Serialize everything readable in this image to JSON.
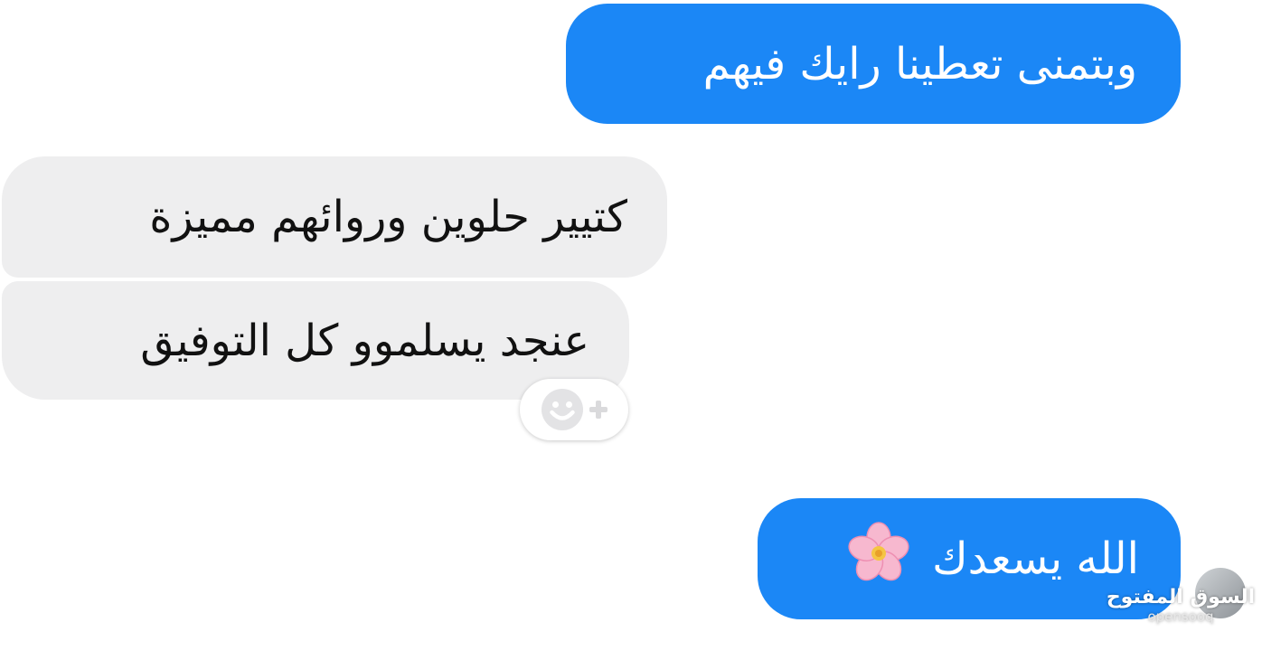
{
  "conversation": {
    "messages": [
      {
        "direction": "outgoing",
        "text": "وبتمنى تعطينا رايك فيهم"
      },
      {
        "direction": "incoming",
        "text": "كتيير حلوين وروائهم مميزة"
      },
      {
        "direction": "incoming",
        "text": "عنجد يسلموو كل التوفيق"
      },
      {
        "direction": "outgoing",
        "text": "الله يسعدك",
        "emoji": "cherry-blossom-icon"
      }
    ]
  },
  "reaction_button": {
    "icons": [
      "smiley-icon",
      "plus-icon"
    ]
  },
  "watermark": {
    "arabic": "السوق المفتوح",
    "latin": "opensooq"
  },
  "colors": {
    "outgoing_bubble": "#1b87f6",
    "incoming_bubble": "#eeeeef",
    "background": "#ffffff"
  }
}
